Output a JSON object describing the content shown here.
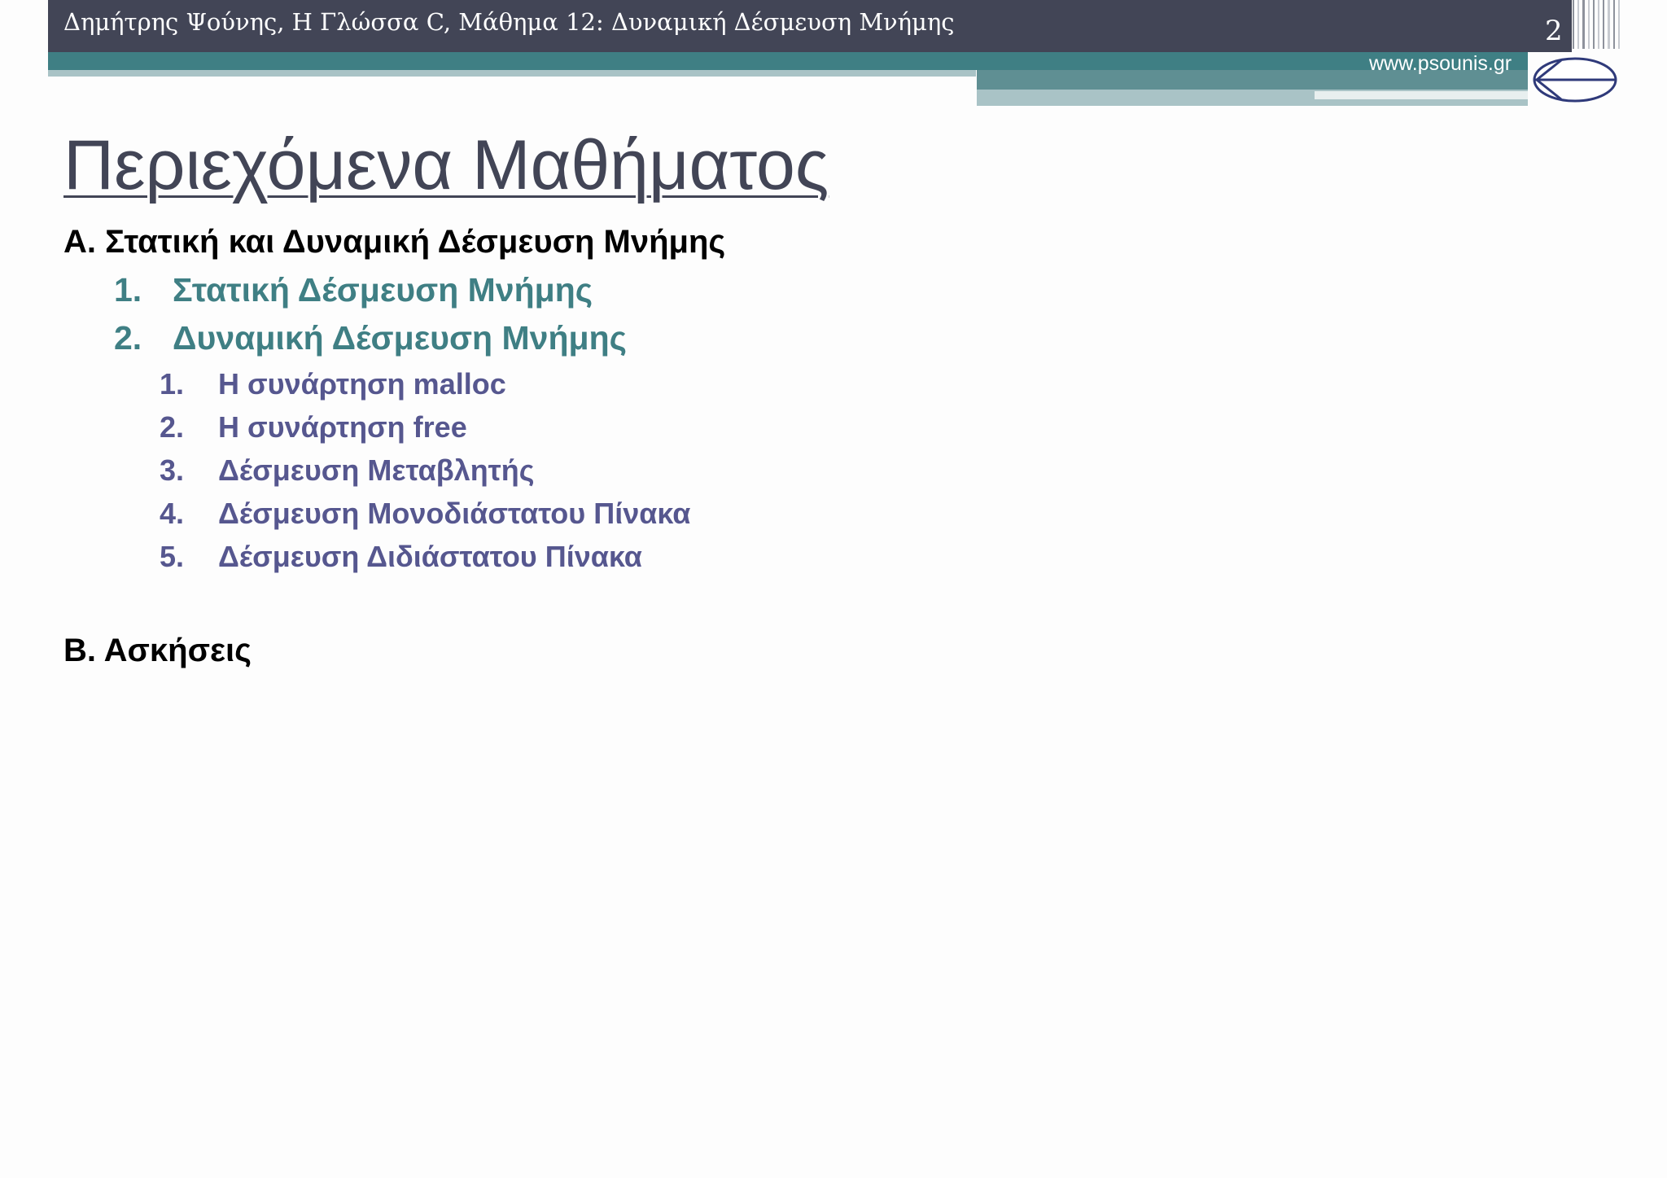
{
  "header": {
    "text": "Δημήτρης Ψούνης, Η Γλώσσα C, Μάθημα 12: Δυναμική Δέσμευση Μνήμης",
    "page_number": "2",
    "website": "www.psounis.gr"
  },
  "title": "Περιεχόμενα Μαθήματος",
  "sections": [
    {
      "label": "Α. Στατική και Δυναμική Δέσμευση Μνήμης",
      "items": [
        {
          "num": "1.",
          "label": "Στατική Δέσμευση Μνήμης"
        },
        {
          "num": "2.",
          "label": "Δυναμική Δέσμευση Μνήμης",
          "subitems": [
            {
              "num": "1.",
              "label": "Η συνάρτηση malloc"
            },
            {
              "num": "2.",
              "label": "Η συνάρτηση free"
            },
            {
              "num": "3.",
              "label": "Δέσμευση Μεταβλητής"
            },
            {
              "num": "4.",
              "label": "Δέσμευση Μονοδιάστατου Πίνακα"
            },
            {
              "num": "5.",
              "label": "Δέσμευση Διδιάστατου Πίνακα"
            }
          ]
        }
      ]
    },
    {
      "label": "Β. Ασκήσεις"
    }
  ],
  "colors": {
    "header_bg": "#424556",
    "teal": "#3f7f84",
    "sub_purple": "#56578f"
  }
}
